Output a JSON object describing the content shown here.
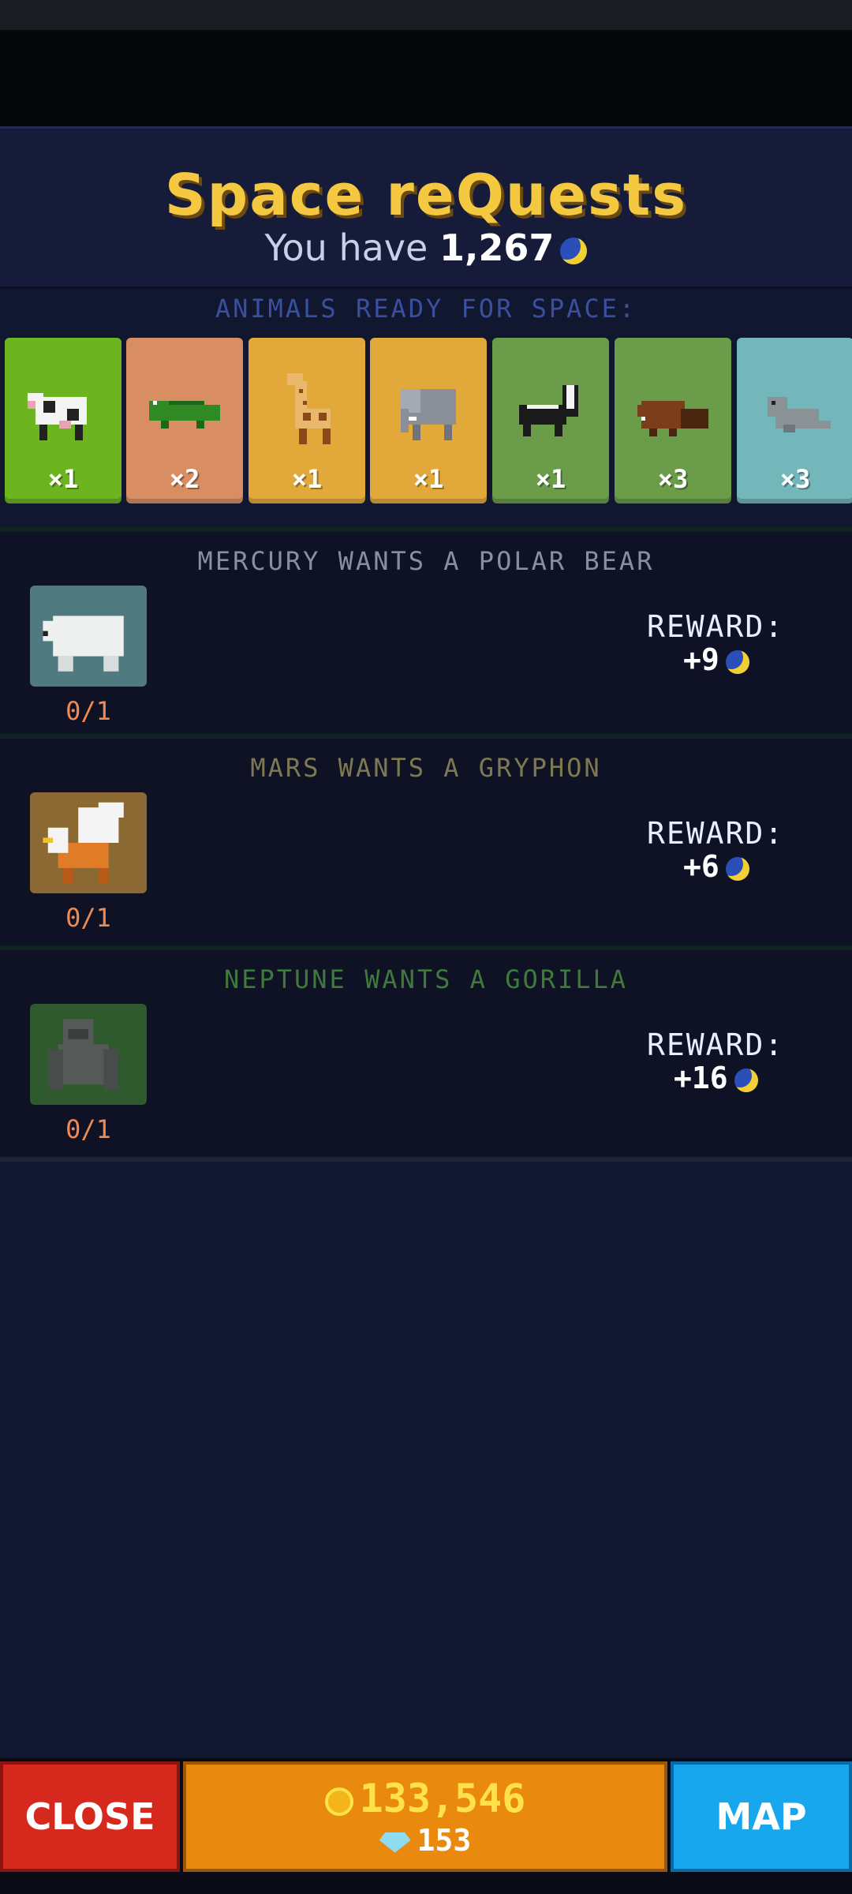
{
  "header": {
    "title": "Space reQuests",
    "balance_prefix": "You have",
    "balance_value": "1,267"
  },
  "animals_section": {
    "label": "ANIMALS READY FOR SPACE:",
    "items": [
      {
        "name": "cow",
        "count": "×1",
        "color": "#6cb520"
      },
      {
        "name": "crocodile",
        "count": "×2",
        "color": "#d88e62"
      },
      {
        "name": "giraffe",
        "count": "×1",
        "color": "#e2a93a"
      },
      {
        "name": "elephant",
        "count": "×1",
        "color": "#e2a93a"
      },
      {
        "name": "skunk",
        "count": "×1",
        "color": "#6a9c4a"
      },
      {
        "name": "beaver",
        "count": "×3",
        "color": "#6a9c4a"
      },
      {
        "name": "seal",
        "count": "×3",
        "color": "#73b7ba"
      }
    ]
  },
  "requests": [
    {
      "title": "MERCURY WANTS A POLAR BEAR",
      "animal_icon": "polar-bear-icon",
      "progress": "0/1",
      "reward_label": "REWARD:",
      "reward_value": "+9",
      "title_color": "#8a8f9e",
      "thumb_color": "#4f7a80"
    },
    {
      "title": "MARS WANTS A GRYPHON",
      "animal_icon": "gryphon-icon",
      "progress": "0/1",
      "reward_label": "REWARD:",
      "reward_value": "+6",
      "title_color": "#7d7a52",
      "thumb_color": "#8a6a32"
    },
    {
      "title": "NEPTUNE WANTS A GORILLA",
      "animal_icon": "gorilla-icon",
      "progress": "0/1",
      "reward_label": "REWARD:",
      "reward_value": "+16",
      "title_color": "#3f7a3a",
      "thumb_color": "#2e5a2e"
    }
  ],
  "bottom_bar": {
    "close_label": "CLOSE",
    "coins": "133,546",
    "gems": "153",
    "map_label": "MAP"
  }
}
